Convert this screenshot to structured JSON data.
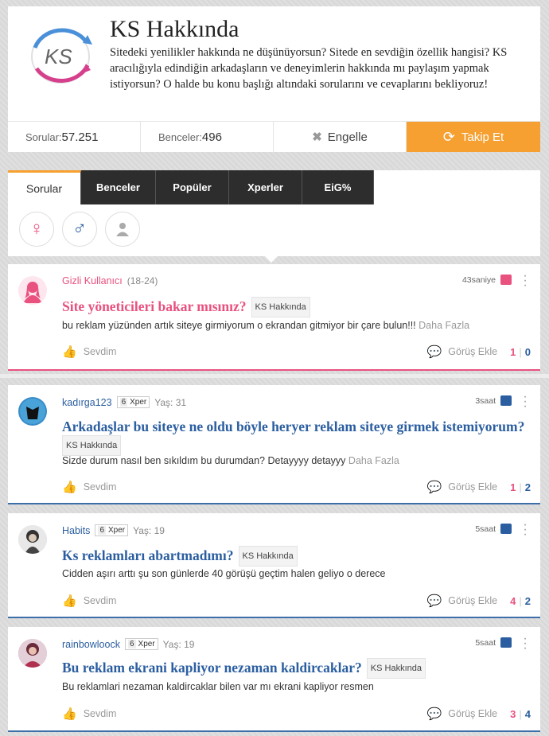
{
  "header": {
    "logo_text": "KS",
    "title": "KS Hakkında",
    "description": "Sitedeki yenilikler hakkında ne düşünüyorsun? Sitede en sevdiğin özellik hangisi? KS aracılığıyla edindiğin arkadaşların ve deneyimlerin hakkında mı paylaşım yapmak istiyorsun? O halde bu konu başlığı altındaki sorularını ve cevaplarını bekliyoruz!",
    "questions_label": "Sorular:",
    "questions_count": "57.251",
    "badges_label": "Benceler:",
    "badges_count": "496",
    "block_label": "Engelle",
    "follow_label": "Takip Et"
  },
  "tabs": [
    "Sorular",
    "Benceler",
    "Popüler",
    "Xperler",
    "EiG%"
  ],
  "gender_filters": [
    "female-icon",
    "male-icon",
    "anonymous-icon"
  ],
  "colors": {
    "accent": "#f5a030",
    "female": "#e9517f",
    "male": "#2b5ea0"
  },
  "questions": [
    {
      "user": "Gizli Kullanıcı",
      "age": "(18-24)",
      "time": "43saniye",
      "title": "Site yöneticileri bakar mısınız?",
      "category": "KS Hakkında",
      "body": "bu reklam yüzünden artık siteye girmiyorum o ekrandan gitmiyor bir çare bulun!!!",
      "more": "Daha Fazla",
      "like": "Sevdim",
      "comment": "Görüş Ekle",
      "count_a": "1",
      "count_b": "0"
    },
    {
      "user": "kadırga123",
      "level": "6",
      "level_label": "Xper",
      "age": "Yaş: 31",
      "time": "3saat",
      "title": "Arkadaşlar bu siteye ne oldu böyle heryer reklam siteye girmek istemiyorum?",
      "category": "KS Hakkında",
      "body": "Sizde durum nasıl ben sıkıldım bu durumdan? Detayyyy detayyy",
      "more": "Daha Fazla",
      "like": "Sevdim",
      "comment": "Görüş Ekle",
      "count_a": "1",
      "count_b": "2"
    },
    {
      "user": "Habits",
      "level": "6",
      "level_label": "Xper",
      "age": "Yaş: 19",
      "time": "5saat",
      "title": "Ks reklamları abartmadımı?",
      "category": "KS Hakkında",
      "body": "Cidden aşırı arttı şu son günlerde 40 görüşü geçtim halen geliyo o derece",
      "like": "Sevdim",
      "comment": "Görüş Ekle",
      "count_a": "4",
      "count_b": "2"
    },
    {
      "user": "rainbowloock",
      "level": "6",
      "level_label": "Xper",
      "age": "Yaş: 19",
      "time": "5saat",
      "title": "Bu reklam ekrani kapliyor nezaman kaldircaklar?",
      "category": "KS Hakkında",
      "body": "Bu reklamlari nezaman kaldircaklar bilen var mı ekrani kapliyor resmen",
      "like": "Sevdim",
      "comment": "Görüş Ekle",
      "count_a": "3",
      "count_b": "4"
    }
  ]
}
